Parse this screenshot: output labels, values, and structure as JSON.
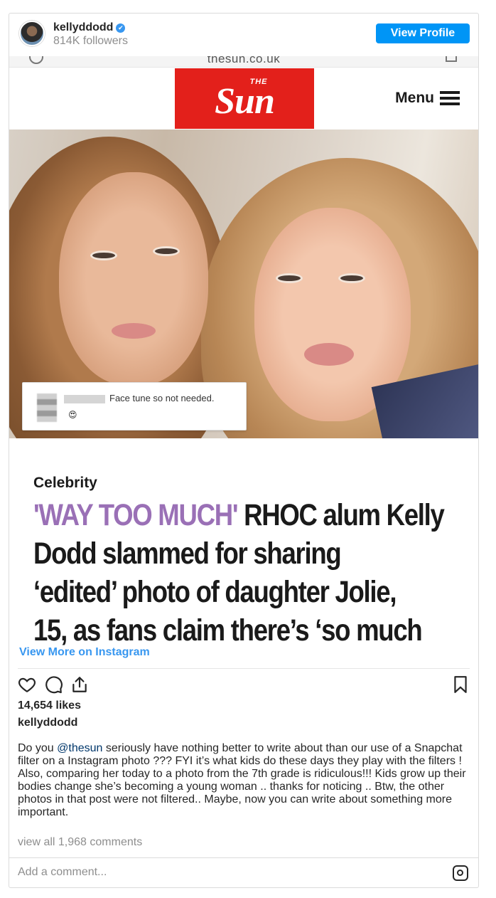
{
  "header": {
    "username": "kellyddodd",
    "verified_mark": "✔",
    "followers": "814K followers",
    "view_profile_label": "View Profile"
  },
  "media": {
    "browser_url": "thesun.co.uk",
    "logo_the": "THE",
    "logo_word": "Sun",
    "menu_label": "Menu",
    "comment_card_text": "Face tune so not needed.",
    "comment_card_emoji": "😍",
    "section_label": "Celebrity",
    "headline_accent": "'WAY TOO MUCH'",
    "headline_line1_rest": " RHOC alum Kelly",
    "headline_line2": "Dodd slammed for sharing",
    "headline_line3": "‘edited’ photo of daughter Jolie,",
    "headline_line4": "15, as fans claim there’s ‘so much"
  },
  "view_more_label": "View More on Instagram",
  "post": {
    "likes": "14,654 likes",
    "owner": "kellyddodd",
    "caption_before": "Do you ",
    "caption_mention": "@thesun",
    "caption_after": " seriously have nothing better to write about than our use of a Snapchat filter on a Instagram photo ??? FYI it’s what kids do these days they play with the filters ! Also, comparing her today to a photo from the 7th grade is ridiculous!!! Kids grow up their bodies change she’s becoming a young woman .. thanks for noticing .. Btw, the other photos in that post were not filtered.. Maybe, now you can write about something more important.",
    "view_comments": "view all 1,968 comments",
    "add_comment_placeholder": "Add a comment..."
  },
  "icons": {
    "like": "heart-icon",
    "comment": "comment-bubble-icon",
    "share": "share-icon",
    "save": "bookmark-icon",
    "instagram": "instagram-icon"
  },
  "colors": {
    "accent_blue": "#0095f6",
    "link_blue": "#3897f0",
    "sun_red": "#e3201b",
    "headline_purple": "#9a70b6"
  }
}
